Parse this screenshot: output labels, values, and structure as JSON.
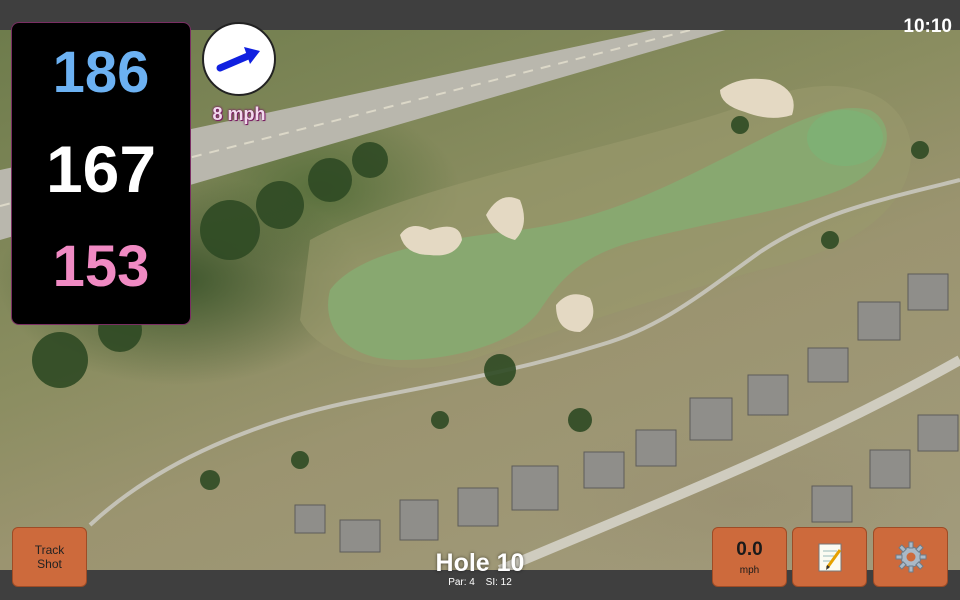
{
  "status": {
    "time": "10:10"
  },
  "yardages": {
    "back": "186",
    "center": "167",
    "front": "153"
  },
  "wind": {
    "speed_label": "8 mph",
    "arrow_icon": "wind-direction-arrow-icon",
    "arrow_color": "#1020e0"
  },
  "controls": {
    "track_shot_line1": "Track",
    "track_shot_line2": "Shot",
    "speed_value": "0.0",
    "speed_unit": "mph",
    "notes_icon": "notepad-icon",
    "settings_icon": "gear-icon"
  },
  "hole": {
    "title": "Hole 10",
    "par_label": "Par: 4",
    "si_label": "SI: 12"
  },
  "colors": {
    "back_yardage": "#6cb1f2",
    "center_yardage": "#ffffff",
    "front_yardage": "#f08ac3",
    "button_orange": "#cd6a3c"
  }
}
